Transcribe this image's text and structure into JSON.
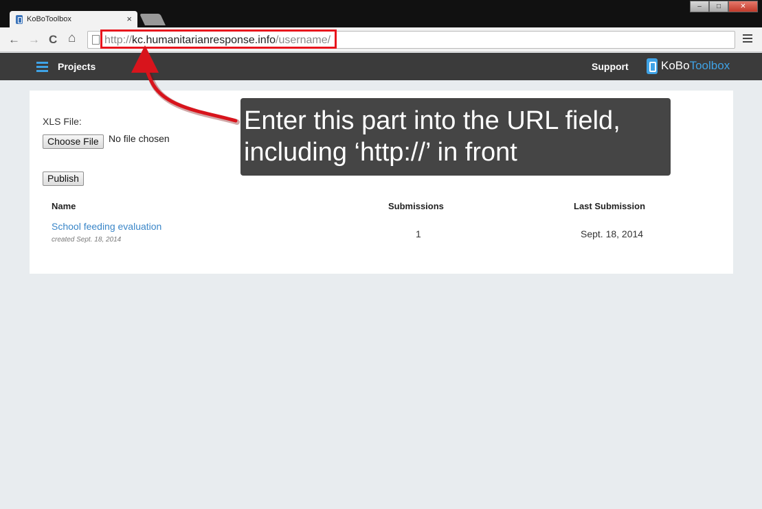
{
  "browser": {
    "tab_title": "KoBoToolbox",
    "tab_close": "×",
    "url_scheme": "http://",
    "url_host": "kc.humanitarianresponse.info",
    "url_path": "/username/",
    "nav": {
      "back": "←",
      "forward": "→",
      "reload": "C",
      "home": "⌂"
    },
    "window": {
      "minimize": "–",
      "maximize": "□",
      "close": "✕"
    }
  },
  "header": {
    "projects_label": "Projects",
    "support_label": "Support",
    "brand_ko": "KoBo",
    "brand_toolbox": "Toolbox",
    "accent_color": "#3fa3e6"
  },
  "form": {
    "xls_label": "XLS File:",
    "choose_file_label": "Choose File",
    "no_file_text": "No file chosen",
    "publish_label": "Publish"
  },
  "table": {
    "headers": {
      "name": "Name",
      "submissions": "Submissions",
      "last_submission": "Last Submission"
    },
    "rows": [
      {
        "name": "School feeding evaluation",
        "created": "created Sept. 18, 2014",
        "submissions": "1",
        "last_submission": "Sept. 18, 2014"
      }
    ]
  },
  "annotation": {
    "line1": "Enter this part into the URL field,",
    "line2": "including ‘http://’ in front",
    "highlight_color": "#e8141c"
  }
}
